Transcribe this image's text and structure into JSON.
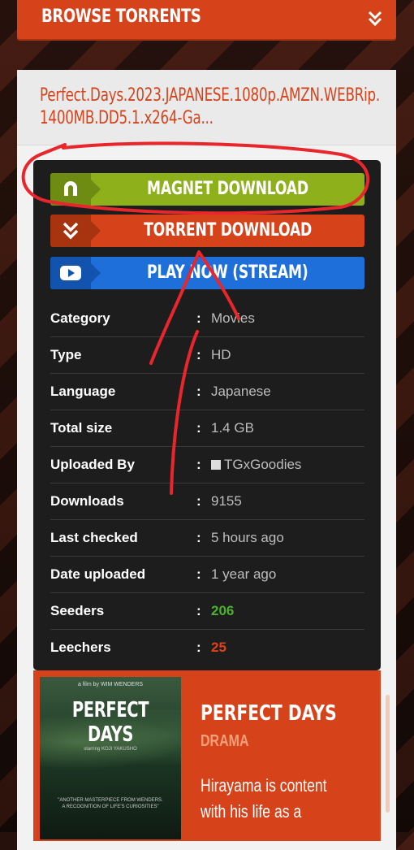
{
  "header": {
    "title": "BROWSE TORRENTS",
    "toggle_icon": "double-chevron-down-icon"
  },
  "torrent": {
    "name": "Perfect.Days.2023.JAPANESE.1080p.AMZN.WEBRip.1400MB.DD5.1.x264-Ga..."
  },
  "buttons": {
    "magnet": {
      "label": "MAGNET DOWNLOAD",
      "icon": "magnet-icon",
      "color": "#8db01b"
    },
    "torrent": {
      "label": "TORRENT DOWNLOAD",
      "icon": "double-chevron-down-icon",
      "color": "#d6431a"
    },
    "stream": {
      "label": "PLAY NOW (STREAM)",
      "icon": "play-icon",
      "color": "#1e6fd9"
    }
  },
  "info": [
    {
      "key": "Category",
      "value": "Movies"
    },
    {
      "key": "Type",
      "value": "HD"
    },
    {
      "key": "Language",
      "value": "Japanese"
    },
    {
      "key": "Total size",
      "value": "1.4 GB"
    },
    {
      "key": "Uploaded By",
      "value": "TGxGoodies"
    },
    {
      "key": "Downloads",
      "value": "9155"
    },
    {
      "key": "Last checked",
      "value": "5 hours ago"
    },
    {
      "key": "Date uploaded",
      "value": "1 year ago"
    },
    {
      "key": "Seeders",
      "value": "206",
      "color": "#4cb12c"
    },
    {
      "key": "Leechers",
      "value": "25",
      "color": "#e0401a"
    }
  ],
  "separator": ":",
  "movie": {
    "poster_title": "PERFECT DAYS",
    "poster_credit": "a film by WIM WENDERS",
    "poster_starring": "starring KOJI YAKUSHO",
    "poster_quote": "\"ANOTHER MASTERPIECE FROM WENDERS. A RECOGNITION OF LIFE'S CURIOSITIES\"",
    "title": "PERFECT DAYS",
    "genre": "DRAMA",
    "description": "Hirayama is content with his life as a"
  },
  "annotation": {
    "color": "#e8262b"
  }
}
